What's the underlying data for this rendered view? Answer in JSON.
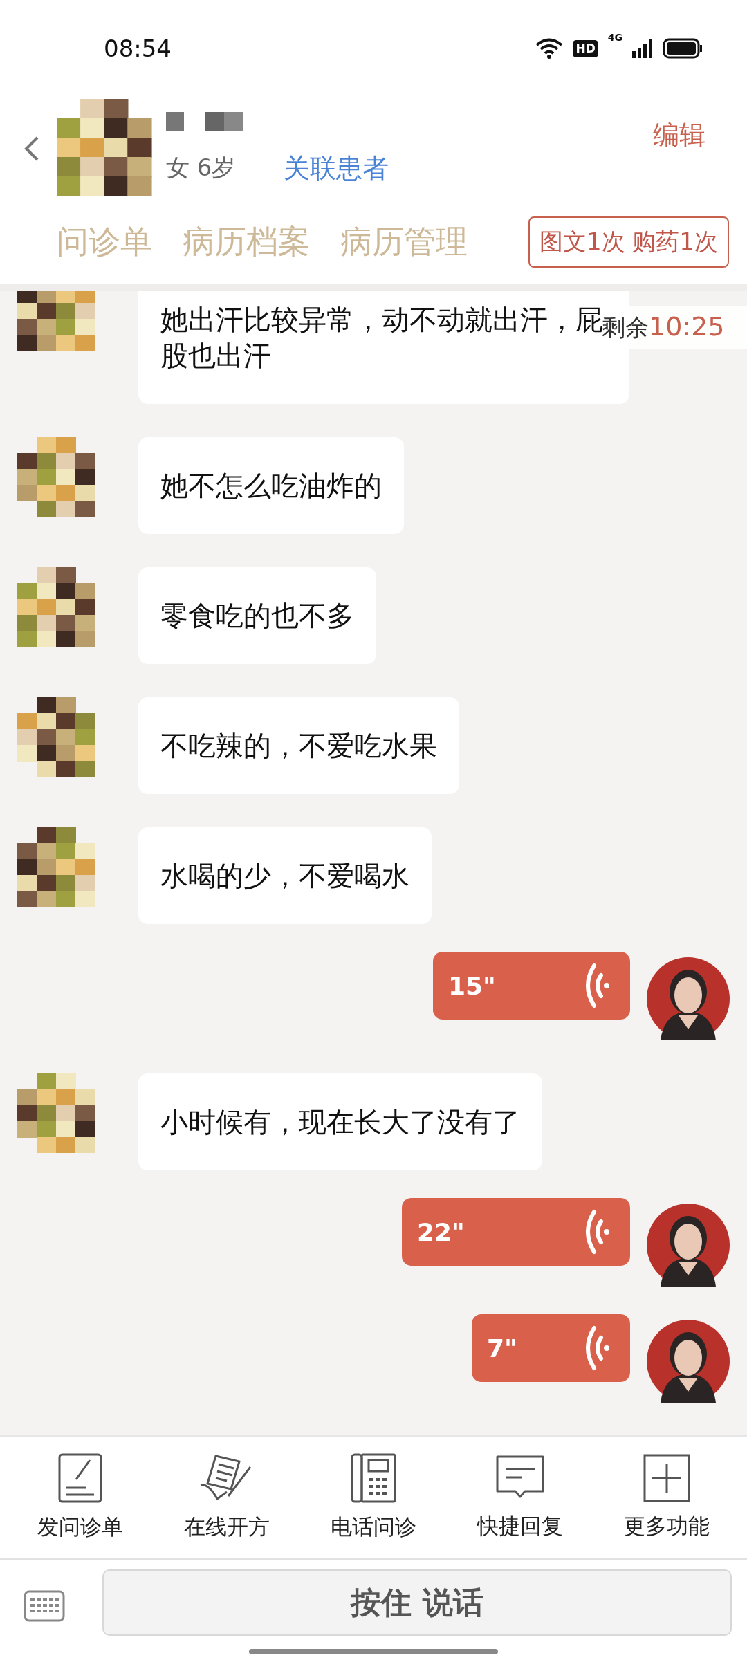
{
  "status_bar": {
    "time": "08:54",
    "hd": "HD",
    "network": "4G"
  },
  "header": {
    "gender_age": "女 6岁",
    "link": "关联患者",
    "edit": "编辑"
  },
  "tabs": [
    {
      "label": "问诊单"
    },
    {
      "label": "病历档案"
    },
    {
      "label": "病历管理"
    }
  ],
  "quota_badge": "图文1次 购药1次",
  "timer": {
    "label": "剩余",
    "time": "10:25"
  },
  "messages": [
    {
      "kind": "text",
      "text": "她出汗比较异常，动不动就出汗，屁股也出汗"
    },
    {
      "kind": "text",
      "text": "她不怎么吃油炸的"
    },
    {
      "kind": "text",
      "text": "零食吃的也不多"
    },
    {
      "kind": "text",
      "text": "不吃辣的，不爱吃水果"
    },
    {
      "kind": "text",
      "text": "水喝的少，不爱喝水"
    },
    {
      "kind": "voice",
      "duration": "15\""
    },
    {
      "kind": "text",
      "text": "小时候有，现在长大了没有了"
    },
    {
      "kind": "voice",
      "duration": "22\""
    },
    {
      "kind": "voice",
      "duration": "7\""
    }
  ],
  "toolbar": [
    {
      "kind": "form",
      "label": "发问诊单"
    },
    {
      "kind": "prescription",
      "label": "在线开方"
    },
    {
      "kind": "phone",
      "label": "电话问诊"
    },
    {
      "kind": "reply",
      "label": "快捷回复"
    },
    {
      "kind": "more",
      "label": "更多功能"
    }
  ],
  "talk_button": "按住 说话"
}
